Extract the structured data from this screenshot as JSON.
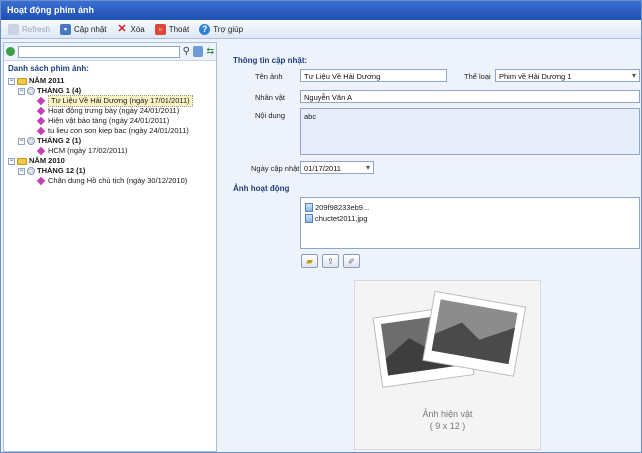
{
  "window": {
    "title": "Hoạt động phim ảnh"
  },
  "toolbar": {
    "refresh_label": "Refresh",
    "update_label": "Cập nhật",
    "delete_label": "Xóa",
    "exit_label": "Thoát",
    "help_label": "Trợ giúp"
  },
  "left": {
    "search_value": "",
    "list_title": "Danh sách phim ảnh:",
    "tree": [
      {
        "level": 0,
        "type": "year",
        "label": "NĂM 2011",
        "expanded": true
      },
      {
        "level": 1,
        "type": "month",
        "label": "THÁNG 1 (4)",
        "expanded": true
      },
      {
        "level": 2,
        "type": "item",
        "label": "Tư Liệu Về Hải Dương (ngày 17/01/2011)",
        "selected": true
      },
      {
        "level": 2,
        "type": "item",
        "label": "Hoạt động trưng bày (ngày 24/01/2011)"
      },
      {
        "level": 2,
        "type": "item",
        "label": "Hiện vật bảo tàng (ngày 24/01/2011)"
      },
      {
        "level": 2,
        "type": "item",
        "label": "tu lieu con son kiep bac (ngày 24/01/2011)"
      },
      {
        "level": 1,
        "type": "month",
        "label": "THÁNG 2 (1)",
        "expanded": true
      },
      {
        "level": 2,
        "type": "item",
        "label": "HCM (ngày 17/02/2011)"
      },
      {
        "level": 0,
        "type": "year",
        "label": "NĂM 2010",
        "expanded": true
      },
      {
        "level": 1,
        "type": "month",
        "label": "THÁNG 12 (1)",
        "expanded": true
      },
      {
        "level": 2,
        "type": "item",
        "label": "Chân dung Hồ chủ tịch (ngày 30/12/2010)"
      }
    ]
  },
  "form": {
    "section_title": "Thông tin cập nhật:",
    "name_label": "Tên ảnh",
    "name_value": "Tư Liệu Về Hải Dương",
    "category_label": "Thể loại",
    "category_value": "Phim về Hải Dương 1",
    "person_label": "Nhân vật",
    "person_value": "Nguyễn Văn A",
    "content_label": "Nội dung",
    "content_value": "abc",
    "date_label": "Ngày cập nhật",
    "date_value": "01/17/2011",
    "photos_title": "Ảnh hoạt động",
    "files": [
      "209f98233eb9...",
      "chuctet2011.jpg"
    ],
    "photo_caption_1": "Ảnh hiện vật",
    "photo_caption_2": "( 9 x 12 )"
  },
  "colors": {
    "title_bar": "#1f4fb4",
    "section_text": "#1f3f80",
    "selected_bg": "#fbf2c4"
  }
}
